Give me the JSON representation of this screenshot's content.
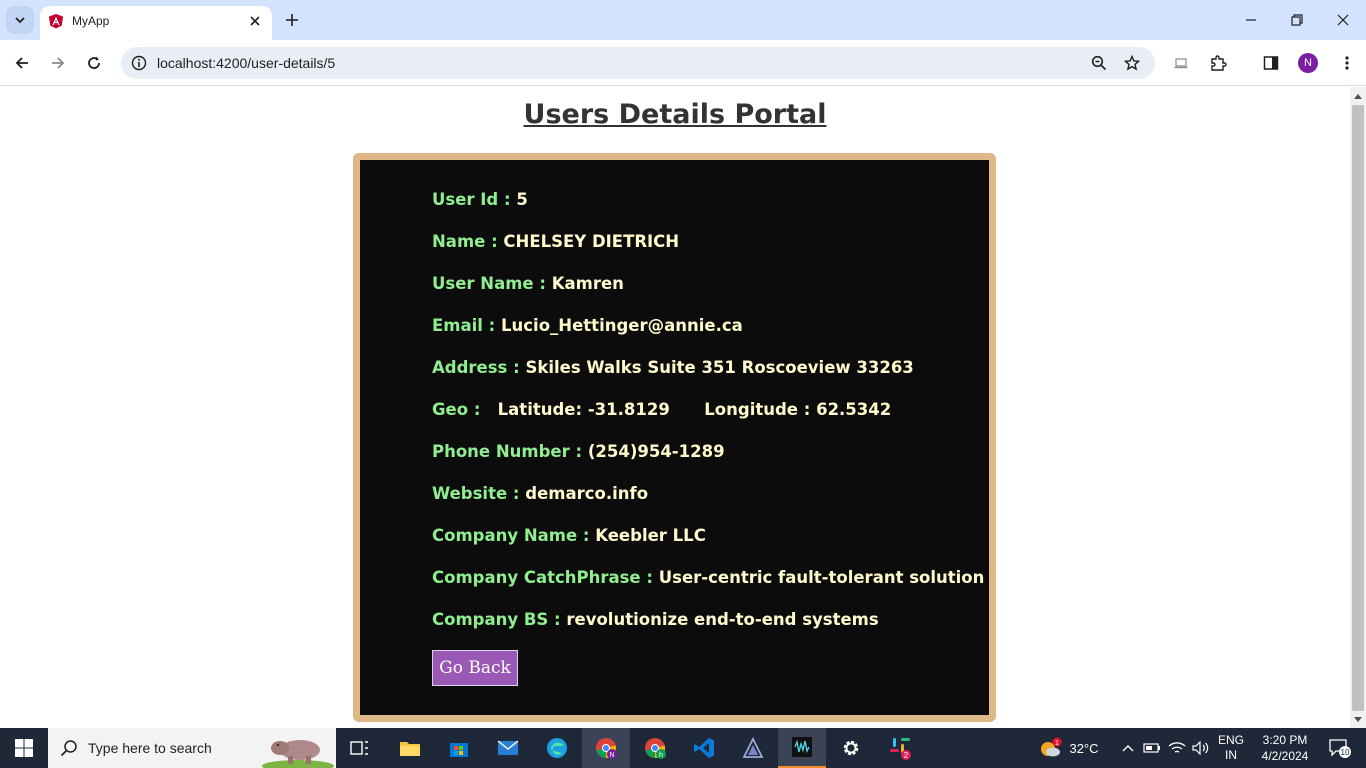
{
  "browser": {
    "tab_title": "MyApp",
    "url": "localhost:4200/user-details/5",
    "profile_initial": "N"
  },
  "page": {
    "title": "Users Details Portal",
    "fields": [
      {
        "label": "User Id :",
        "value": "5"
      },
      {
        "label": "Name :",
        "value": "CHELSEY DIETRICH"
      },
      {
        "label": "User Name :",
        "value": "Kamren"
      },
      {
        "label": "Email :",
        "value": "Lucio_Hettinger@annie.ca"
      },
      {
        "label": "Address :",
        "value": "Skiles Walks Suite 351 Roscoeview 33263"
      },
      {
        "label": "Geo :",
        "value": ""
      },
      {
        "label": "Phone Number :",
        "value": "(254)954-1289"
      },
      {
        "label": "Website :",
        "value": "demarco.info"
      },
      {
        "label": "Company Name :",
        "value": "Keebler LLC"
      },
      {
        "label": "Company CatchPhrase :",
        "value": "User-centric fault-tolerant solution"
      },
      {
        "label": "Company BS :",
        "value": "revolutionize end-to-end systems"
      }
    ],
    "geo": {
      "latitude": "Latitude: -31.8129",
      "longitude": "Longitude : 62.5342"
    },
    "go_back_label": "Go Back",
    "colors": {
      "card_bg": "#0c0c0d",
      "card_border": "#deb887",
      "label": "#90ee90",
      "value": "#fffacd",
      "button": "#9b59b6"
    }
  },
  "taskbar": {
    "search_placeholder": "Type here to search",
    "weather": "32°C",
    "weather_badge": "1",
    "lang_top": "ENG",
    "lang_bottom": "IN",
    "time": "3:20 PM",
    "date": "4/2/2024",
    "notifications": "10",
    "slack_badge": "2"
  }
}
